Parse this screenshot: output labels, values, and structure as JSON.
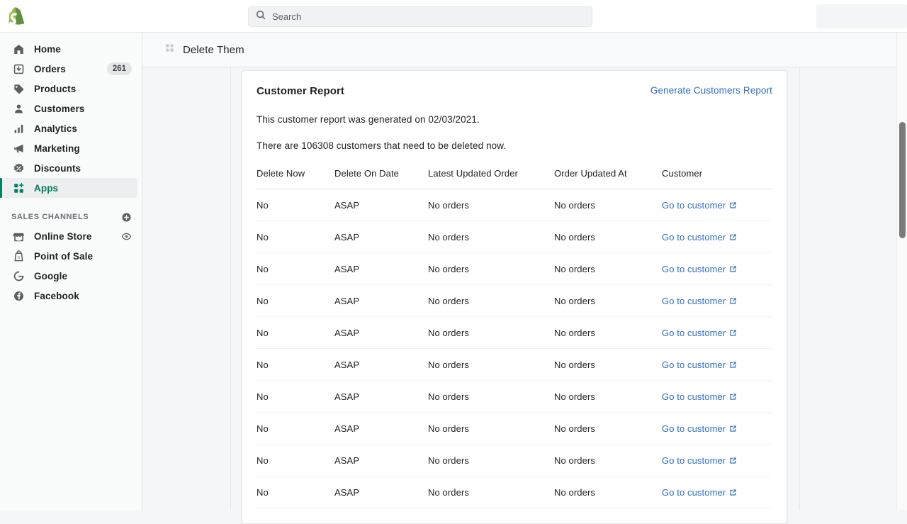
{
  "topbar": {
    "logo_icon": "shopify-bag-logo",
    "search": {
      "placeholder": "Search",
      "value": "",
      "icon": "search-icon"
    }
  },
  "sidebar": {
    "items": [
      {
        "label": "Home",
        "icon": "home-icon",
        "badge": null,
        "active": false
      },
      {
        "label": "Orders",
        "icon": "orders-inbox-icon",
        "badge": "261",
        "active": false
      },
      {
        "label": "Products",
        "icon": "product-tag-icon",
        "badge": null,
        "active": false
      },
      {
        "label": "Customers",
        "icon": "customer-person-icon",
        "badge": null,
        "active": false
      },
      {
        "label": "Analytics",
        "icon": "analytics-bars-icon",
        "badge": null,
        "active": false
      },
      {
        "label": "Marketing",
        "icon": "marketing-megaphone-icon",
        "badge": null,
        "active": false
      },
      {
        "label": "Discounts",
        "icon": "discount-percent-icon",
        "badge": null,
        "active": false
      },
      {
        "label": "Apps",
        "icon": "apps-grid-plus-icon",
        "badge": null,
        "active": true
      }
    ],
    "section": {
      "title": "SALES CHANNELS",
      "add_icon": "add-circle-icon",
      "channels": [
        {
          "label": "Online Store",
          "icon": "storefront-icon",
          "trailing_icon": "eye-view-icon"
        },
        {
          "label": "Point of Sale",
          "icon": "point-of-sale-icon",
          "trailing_icon": null
        },
        {
          "label": "Google",
          "icon": "google-g-icon",
          "trailing_icon": null
        },
        {
          "label": "Facebook",
          "icon": "facebook-f-icon",
          "trailing_icon": null
        }
      ]
    }
  },
  "app_header": {
    "icon": "apps-grid-icon",
    "title": "Delete Them"
  },
  "card": {
    "title": "Customer Report",
    "generate_label": "Generate Customers Report",
    "paragraph_1": "This customer report was generated on 02/03/2021.",
    "paragraph_2": "There are 106308 customers that need to be deleted now.",
    "table": {
      "headers": [
        "Delete Now",
        "Delete On Date",
        "Latest Updated Order",
        "Order Updated At",
        "Customer"
      ],
      "link_icon": "external-link-icon",
      "rows": [
        {
          "delete_now": "No",
          "delete_on_date": "ASAP",
          "latest_updated_order": "No orders",
          "order_updated_at": "No orders",
          "customer_link": "Go to customer"
        },
        {
          "delete_now": "No",
          "delete_on_date": "ASAP",
          "latest_updated_order": "No orders",
          "order_updated_at": "No orders",
          "customer_link": "Go to customer"
        },
        {
          "delete_now": "No",
          "delete_on_date": "ASAP",
          "latest_updated_order": "No orders",
          "order_updated_at": "No orders",
          "customer_link": "Go to customer"
        },
        {
          "delete_now": "No",
          "delete_on_date": "ASAP",
          "latest_updated_order": "No orders",
          "order_updated_at": "No orders",
          "customer_link": "Go to customer"
        },
        {
          "delete_now": "No",
          "delete_on_date": "ASAP",
          "latest_updated_order": "No orders",
          "order_updated_at": "No orders",
          "customer_link": "Go to customer"
        },
        {
          "delete_now": "No",
          "delete_on_date": "ASAP",
          "latest_updated_order": "No orders",
          "order_updated_at": "No orders",
          "customer_link": "Go to customer"
        },
        {
          "delete_now": "No",
          "delete_on_date": "ASAP",
          "latest_updated_order": "No orders",
          "order_updated_at": "No orders",
          "customer_link": "Go to customer"
        },
        {
          "delete_now": "No",
          "delete_on_date": "ASAP",
          "latest_updated_order": "No orders",
          "order_updated_at": "No orders",
          "customer_link": "Go to customer"
        },
        {
          "delete_now": "No",
          "delete_on_date": "ASAP",
          "latest_updated_order": "No orders",
          "order_updated_at": "No orders",
          "customer_link": "Go to customer"
        },
        {
          "delete_now": "No",
          "delete_on_date": "ASAP",
          "latest_updated_order": "No orders",
          "order_updated_at": "No orders",
          "customer_link": "Go to customer"
        }
      ]
    }
  },
  "colors": {
    "brand_green": "#008060",
    "link_blue": "#2c6ecb",
    "text_primary": "#202223",
    "text_subdued": "#6d7175",
    "page_background": "#f4f6f8",
    "sidebar_background": "#fafbfb"
  }
}
